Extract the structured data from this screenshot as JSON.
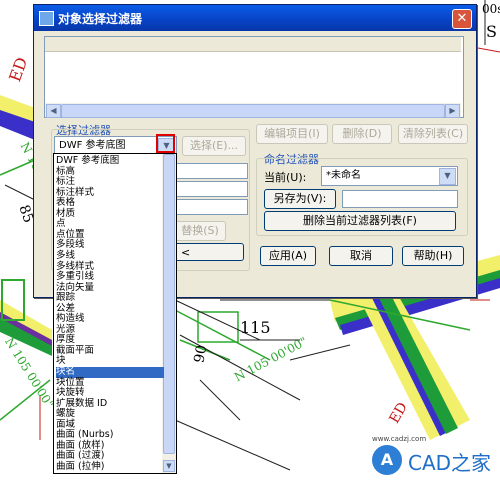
{
  "dialog": {
    "title": "对象选择过滤器",
    "close_glyph": "✕"
  },
  "filter_group": {
    "label": "选择过滤器",
    "combo_value": "DWF 参考底图",
    "select_button": "选择(E)...",
    "replace_button": "替换(S)",
    "back_glyph": "<"
  },
  "edit_buttons": {
    "edit_item": "编辑项目(I)",
    "delete": "删除(D)",
    "clear_list": "清除列表(C)"
  },
  "named_filter": {
    "label": "命名过滤器",
    "current_label": "当前(U):",
    "current_value": "*未命名",
    "save_as_button": "另存为(V):",
    "delete_current_button": "删除当前过滤器列表(F)"
  },
  "footer": {
    "apply": "应用(A)",
    "cancel": "取消",
    "help": "帮助(H)"
  },
  "dropdown_items": [
    "DWF 参考底图",
    "标高",
    "标注",
    "标注样式",
    "表格",
    "材质",
    "点",
    "点位置",
    "多段线",
    "多线",
    "多线样式",
    "多重引线",
    "法向矢量",
    "跟踪",
    "公差",
    "构造线",
    "光源",
    "厚度",
    "截面平面",
    "块",
    "块名",
    "块位置",
    "块旋转",
    "扩展数据 ID",
    "螺旋",
    "面域",
    "曲面 (Nurbs)",
    "曲面 (放样)",
    "曲面 (过渡)",
    "曲面 (拉伸)"
  ],
  "dropdown_selected_index": 20,
  "cad_labels": {
    "n_label_1": "N 105 00'00\"",
    "n_label_2": "N 105 00'00\"",
    "n_label_3": "N 105 00'00\"",
    "num_115": "115",
    "num_85": "85",
    "num_90": "90",
    "top_right": "00s",
    "letter_s": "S",
    "ed_top": "ED",
    "ed_bottom": "ED"
  },
  "watermark": {
    "logo_letter": "A",
    "brand": "CAD之家",
    "site": "www.cadzj.com"
  },
  "colors": {
    "title_bar": "#0842c4",
    "selection": "#316ac5",
    "highlight_box": "#e00000",
    "cad_green": "#2ea82e",
    "cad_red": "#c81818"
  }
}
